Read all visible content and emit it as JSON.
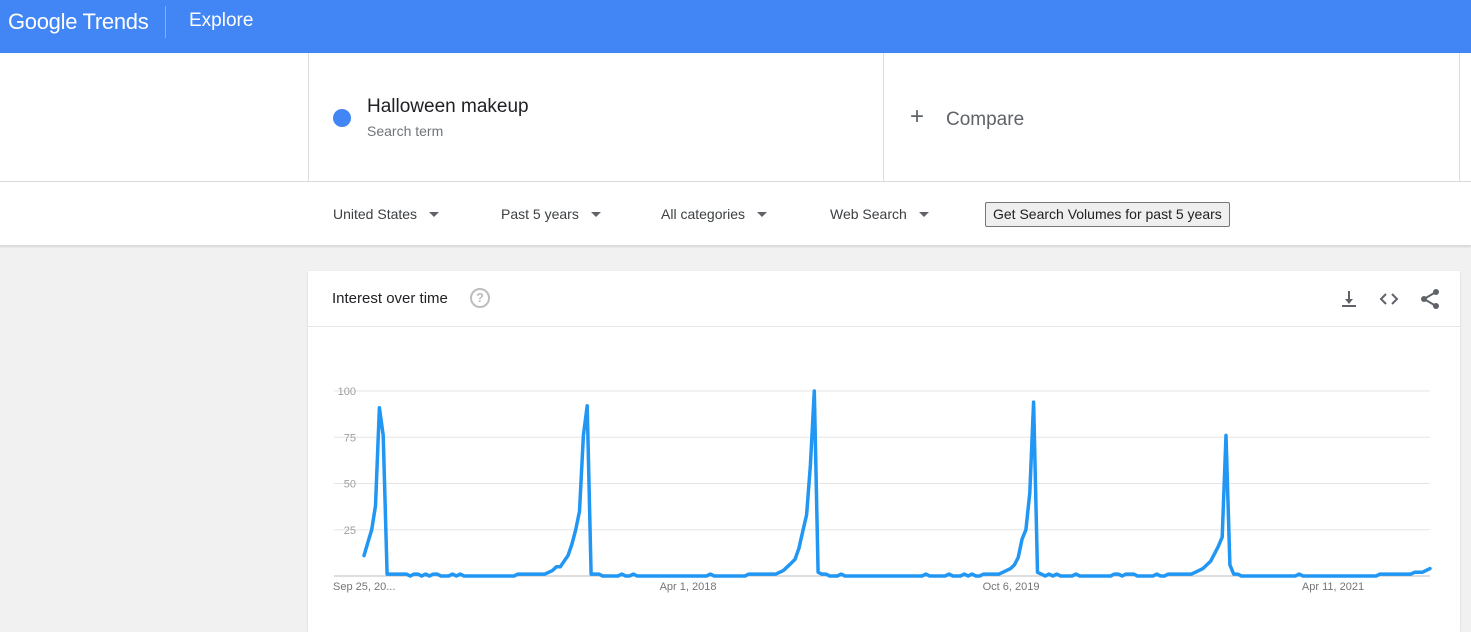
{
  "header": {
    "brand": "Google Trends",
    "section": "Explore"
  },
  "search_term": {
    "name": "Halloween makeup",
    "type": "Search term",
    "color": "#4285f4"
  },
  "compare": {
    "label": "Compare"
  },
  "filters": [
    {
      "label": "United States"
    },
    {
      "label": "Past 5 years"
    },
    {
      "label": "All categories"
    },
    {
      "label": "Web Search"
    }
  ],
  "volume_button": "Get Search Volumes for past 5 years",
  "card": {
    "title": "Interest over time",
    "tools": [
      "download-icon",
      "embed-code-icon",
      "share-icon"
    ]
  },
  "chart_data": {
    "type": "line",
    "ylim": [
      0,
      100
    ],
    "y_ticks": [
      25,
      50,
      75,
      100
    ],
    "x_tick_labels": [
      "Sep 25, 20...",
      "Apr 1, 2018",
      "Oct 6, 2019",
      "Apr 11, 2021"
    ],
    "grid": true,
    "series_color": "#2196f3",
    "series": [
      {
        "name": "Halloween makeup",
        "points": [
          [
            0,
            11
          ],
          [
            1,
            18
          ],
          [
            2,
            25
          ],
          [
            3,
            38
          ],
          [
            4,
            91
          ],
          [
            5,
            76
          ],
          [
            6,
            1
          ],
          [
            7,
            1
          ],
          [
            8,
            1
          ],
          [
            9,
            1
          ],
          [
            10,
            1
          ],
          [
            11,
            1
          ],
          [
            12,
            0
          ],
          [
            13,
            1
          ],
          [
            14,
            1
          ],
          [
            15,
            0
          ],
          [
            16,
            1
          ],
          [
            17,
            0
          ],
          [
            18,
            1
          ],
          [
            19,
            1
          ],
          [
            20,
            0
          ],
          [
            21,
            0
          ],
          [
            22,
            0
          ],
          [
            23,
            1
          ],
          [
            24,
            0
          ],
          [
            25,
            1
          ],
          [
            26,
            0
          ],
          [
            27,
            0
          ],
          [
            28,
            0
          ],
          [
            29,
            0
          ],
          [
            30,
            0
          ],
          [
            31,
            0
          ],
          [
            32,
            0
          ],
          [
            33,
            0
          ],
          [
            34,
            0
          ],
          [
            35,
            0
          ],
          [
            36,
            0
          ],
          [
            37,
            0
          ],
          [
            38,
            0
          ],
          [
            39,
            0
          ],
          [
            40,
            1
          ],
          [
            41,
            1
          ],
          [
            42,
            1
          ],
          [
            43,
            1
          ],
          [
            44,
            1
          ],
          [
            45,
            1
          ],
          [
            46,
            1
          ],
          [
            47,
            1
          ],
          [
            48,
            2
          ],
          [
            49,
            3
          ],
          [
            50,
            5
          ],
          [
            51,
            5
          ],
          [
            52,
            8
          ],
          [
            53,
            11
          ],
          [
            54,
            17
          ],
          [
            55,
            25
          ],
          [
            56,
            35
          ],
          [
            57,
            76
          ],
          [
            58,
            92
          ],
          [
            59,
            1
          ],
          [
            60,
            1
          ],
          [
            61,
            1
          ],
          [
            62,
            0
          ],
          [
            63,
            0
          ],
          [
            64,
            0
          ],
          [
            65,
            0
          ],
          [
            66,
            0
          ],
          [
            67,
            1
          ],
          [
            68,
            0
          ],
          [
            69,
            0
          ],
          [
            70,
            1
          ],
          [
            71,
            0
          ],
          [
            72,
            0
          ],
          [
            73,
            0
          ],
          [
            74,
            0
          ],
          [
            75,
            0
          ],
          [
            76,
            0
          ],
          [
            77,
            0
          ],
          [
            78,
            0
          ],
          [
            79,
            0
          ],
          [
            80,
            0
          ],
          [
            81,
            0
          ],
          [
            82,
            0
          ],
          [
            83,
            0
          ],
          [
            84,
            0
          ],
          [
            85,
            0
          ],
          [
            86,
            0
          ],
          [
            87,
            0
          ],
          [
            88,
            0
          ],
          [
            89,
            0
          ],
          [
            90,
            1
          ],
          [
            91,
            0
          ],
          [
            92,
            0
          ],
          [
            93,
            0
          ],
          [
            94,
            0
          ],
          [
            95,
            0
          ],
          [
            96,
            0
          ],
          [
            97,
            0
          ],
          [
            98,
            0
          ],
          [
            99,
            0
          ],
          [
            100,
            1
          ],
          [
            101,
            1
          ],
          [
            102,
            1
          ],
          [
            103,
            1
          ],
          [
            104,
            1
          ],
          [
            105,
            1
          ],
          [
            106,
            1
          ],
          [
            107,
            1
          ],
          [
            108,
            2
          ],
          [
            109,
            3
          ],
          [
            110,
            5
          ],
          [
            111,
            7
          ],
          [
            112,
            9
          ],
          [
            113,
            15
          ],
          [
            114,
            24
          ],
          [
            115,
            33
          ],
          [
            116,
            60
          ],
          [
            117,
            100
          ],
          [
            118,
            2
          ],
          [
            119,
            1
          ],
          [
            120,
            1
          ],
          [
            121,
            0
          ],
          [
            122,
            0
          ],
          [
            123,
            0
          ],
          [
            124,
            1
          ],
          [
            125,
            0
          ],
          [
            126,
            0
          ],
          [
            127,
            0
          ],
          [
            128,
            0
          ],
          [
            129,
            0
          ],
          [
            130,
            0
          ],
          [
            131,
            0
          ],
          [
            132,
            0
          ],
          [
            133,
            0
          ],
          [
            134,
            0
          ],
          [
            135,
            0
          ],
          [
            136,
            0
          ],
          [
            137,
            0
          ],
          [
            138,
            0
          ],
          [
            139,
            0
          ],
          [
            140,
            0
          ],
          [
            141,
            0
          ],
          [
            142,
            0
          ],
          [
            143,
            0
          ],
          [
            144,
            0
          ],
          [
            145,
            0
          ],
          [
            146,
            1
          ],
          [
            147,
            0
          ],
          [
            148,
            0
          ],
          [
            149,
            0
          ],
          [
            150,
            0
          ],
          [
            151,
            0
          ],
          [
            152,
            1
          ],
          [
            153,
            0
          ],
          [
            154,
            0
          ],
          [
            155,
            0
          ],
          [
            156,
            1
          ],
          [
            157,
            0
          ],
          [
            158,
            1
          ],
          [
            159,
            0
          ],
          [
            160,
            0
          ],
          [
            161,
            1
          ],
          [
            162,
            1
          ],
          [
            163,
            1
          ],
          [
            164,
            1
          ],
          [
            165,
            1
          ],
          [
            166,
            2
          ],
          [
            167,
            3
          ],
          [
            168,
            4
          ],
          [
            169,
            6
          ],
          [
            170,
            10
          ],
          [
            171,
            20
          ],
          [
            172,
            25
          ],
          [
            173,
            45
          ],
          [
            174,
            94
          ],
          [
            175,
            2
          ],
          [
            176,
            1
          ],
          [
            177,
            0
          ],
          [
            178,
            1
          ],
          [
            179,
            0
          ],
          [
            180,
            1
          ],
          [
            181,
            0
          ],
          [
            182,
            0
          ],
          [
            183,
            0
          ],
          [
            184,
            0
          ],
          [
            185,
            1
          ],
          [
            186,
            0
          ],
          [
            187,
            0
          ],
          [
            188,
            0
          ],
          [
            189,
            0
          ],
          [
            190,
            0
          ],
          [
            191,
            0
          ],
          [
            192,
            0
          ],
          [
            193,
            0
          ],
          [
            194,
            0
          ],
          [
            195,
            1
          ],
          [
            196,
            1
          ],
          [
            197,
            0
          ],
          [
            198,
            1
          ],
          [
            199,
            1
          ],
          [
            200,
            1
          ],
          [
            201,
            0
          ],
          [
            202,
            0
          ],
          [
            203,
            0
          ],
          [
            204,
            0
          ],
          [
            205,
            0
          ],
          [
            206,
            1
          ],
          [
            207,
            0
          ],
          [
            208,
            0
          ],
          [
            209,
            1
          ],
          [
            210,
            1
          ],
          [
            211,
            1
          ],
          [
            212,
            1
          ],
          [
            213,
            1
          ],
          [
            214,
            1
          ],
          [
            215,
            1
          ],
          [
            216,
            2
          ],
          [
            217,
            3
          ],
          [
            218,
            4
          ],
          [
            219,
            6
          ],
          [
            220,
            8
          ],
          [
            221,
            12
          ],
          [
            222,
            16
          ],
          [
            223,
            21
          ],
          [
            224,
            76
          ],
          [
            225,
            6
          ],
          [
            226,
            1
          ],
          [
            227,
            1
          ],
          [
            228,
            0
          ],
          [
            229,
            0
          ],
          [
            230,
            0
          ],
          [
            231,
            0
          ],
          [
            232,
            0
          ],
          [
            233,
            0
          ],
          [
            234,
            0
          ],
          [
            235,
            0
          ],
          [
            236,
            0
          ],
          [
            237,
            0
          ],
          [
            238,
            0
          ],
          [
            239,
            0
          ],
          [
            240,
            0
          ],
          [
            241,
            0
          ],
          [
            242,
            0
          ],
          [
            243,
            1
          ],
          [
            244,
            0
          ],
          [
            245,
            0
          ],
          [
            246,
            0
          ],
          [
            247,
            0
          ],
          [
            248,
            0
          ],
          [
            249,
            0
          ],
          [
            250,
            0
          ],
          [
            251,
            0
          ],
          [
            252,
            0
          ],
          [
            253,
            0
          ],
          [
            254,
            0
          ],
          [
            255,
            0
          ],
          [
            256,
            0
          ],
          [
            257,
            0
          ],
          [
            258,
            0
          ],
          [
            259,
            0
          ],
          [
            260,
            0
          ],
          [
            261,
            0
          ],
          [
            262,
            0
          ],
          [
            263,
            0
          ],
          [
            264,
            1
          ],
          [
            265,
            1
          ],
          [
            266,
            1
          ],
          [
            267,
            1
          ],
          [
            268,
            1
          ],
          [
            269,
            1
          ],
          [
            270,
            1
          ],
          [
            271,
            1
          ],
          [
            272,
            1
          ],
          [
            273,
            2
          ],
          [
            274,
            2
          ],
          [
            275,
            2
          ],
          [
            276,
            3
          ],
          [
            277,
            4
          ]
        ]
      }
    ]
  }
}
